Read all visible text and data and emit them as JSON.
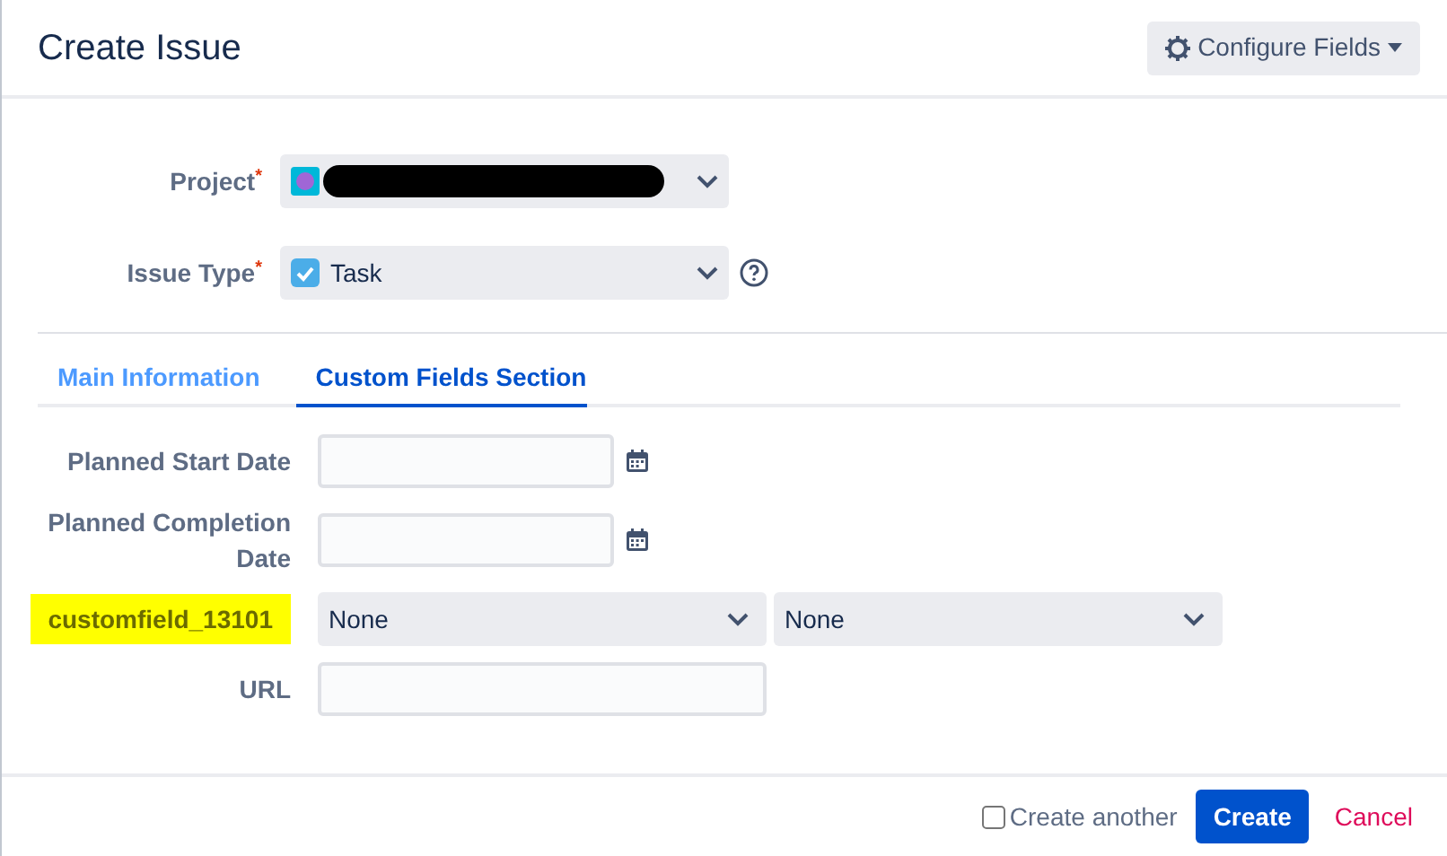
{
  "dialog": {
    "title": "Create Issue",
    "configure_button": "Configure Fields"
  },
  "top_fields": [
    {
      "label": "Project",
      "required_mark": "*",
      "kind": "project",
      "value_redacted": true
    },
    {
      "label": "Issue Type",
      "required_mark": "*",
      "kind": "issuetype",
      "value": "Task",
      "help": true
    }
  ],
  "tabs": [
    {
      "label": "Main Information",
      "selected": false
    },
    {
      "label": "Custom Fields Section",
      "selected": true
    }
  ],
  "fields": [
    {
      "label": "Planned Start Date",
      "kind": "date",
      "highlighted": false
    },
    {
      "label": "Planned Completion Date",
      "kind": "date",
      "highlighted": false
    },
    {
      "label": "customfield_13101",
      "kind": "cascade",
      "highlighted": true,
      "values": [
        "None",
        "None"
      ]
    },
    {
      "label": "URL",
      "kind": "text",
      "highlighted": false
    }
  ],
  "footer": {
    "create_another": {
      "label": "Create another",
      "checked": false
    },
    "create_button": "Create",
    "cancel_link": "Cancel"
  }
}
